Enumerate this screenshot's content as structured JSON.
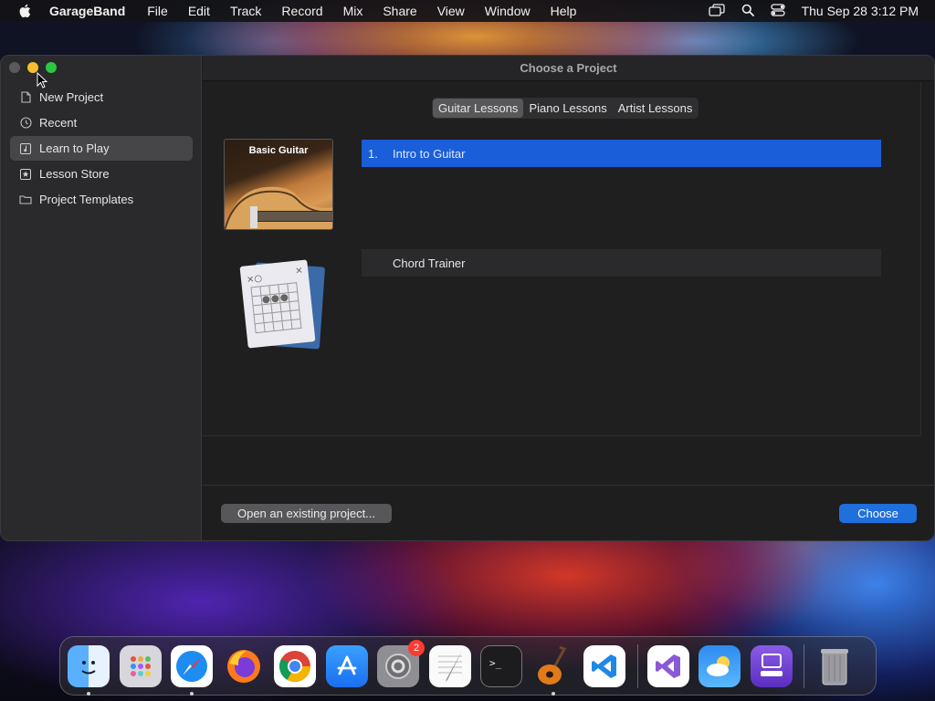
{
  "menubar": {
    "app_name": "GarageBand",
    "items": [
      "File",
      "Edit",
      "Track",
      "Record",
      "Mix",
      "Share",
      "View",
      "Window",
      "Help"
    ],
    "clock": "Thu Sep 28  3:12 PM"
  },
  "window": {
    "title": "Choose a Project",
    "sidebar": {
      "items": [
        {
          "label": "New Project",
          "icon": "document-icon"
        },
        {
          "label": "Recent",
          "icon": "clock-icon"
        },
        {
          "label": "Learn to Play",
          "icon": "music-note-icon",
          "active": true
        },
        {
          "label": "Lesson Store",
          "icon": "store-icon"
        },
        {
          "label": "Project Templates",
          "icon": "folder-icon"
        }
      ]
    },
    "tabs": [
      "Guitar Lessons",
      "Piano Lessons",
      "Artist Lessons"
    ],
    "selected_tab": "Guitar Lessons",
    "lesson_groups": [
      {
        "thumbnail_label": "Basic Guitar",
        "lessons": [
          {
            "number": "1.",
            "title": "Intro to Guitar",
            "selected": true
          }
        ]
      },
      {
        "thumbnail_label": "",
        "lessons": [
          {
            "number": "",
            "title": "Chord Trainer",
            "selected": false
          }
        ]
      }
    ],
    "buttons": {
      "open_existing": "Open an existing project...",
      "choose": "Choose"
    }
  },
  "dock": {
    "apps": [
      "Finder",
      "Launchpad",
      "Safari",
      "Firefox",
      "Chrome",
      "App Store",
      "System Settings",
      "TextEdit",
      "Terminal",
      "GarageBand",
      "Visual Studio Code",
      "Visual Studio",
      "Weather",
      "Simulator",
      "Trash"
    ],
    "settings_badge": "2"
  },
  "colors": {
    "accent": "#1a5ed9",
    "choose_button": "#1f6fdc",
    "badge": "#ff3b30"
  }
}
